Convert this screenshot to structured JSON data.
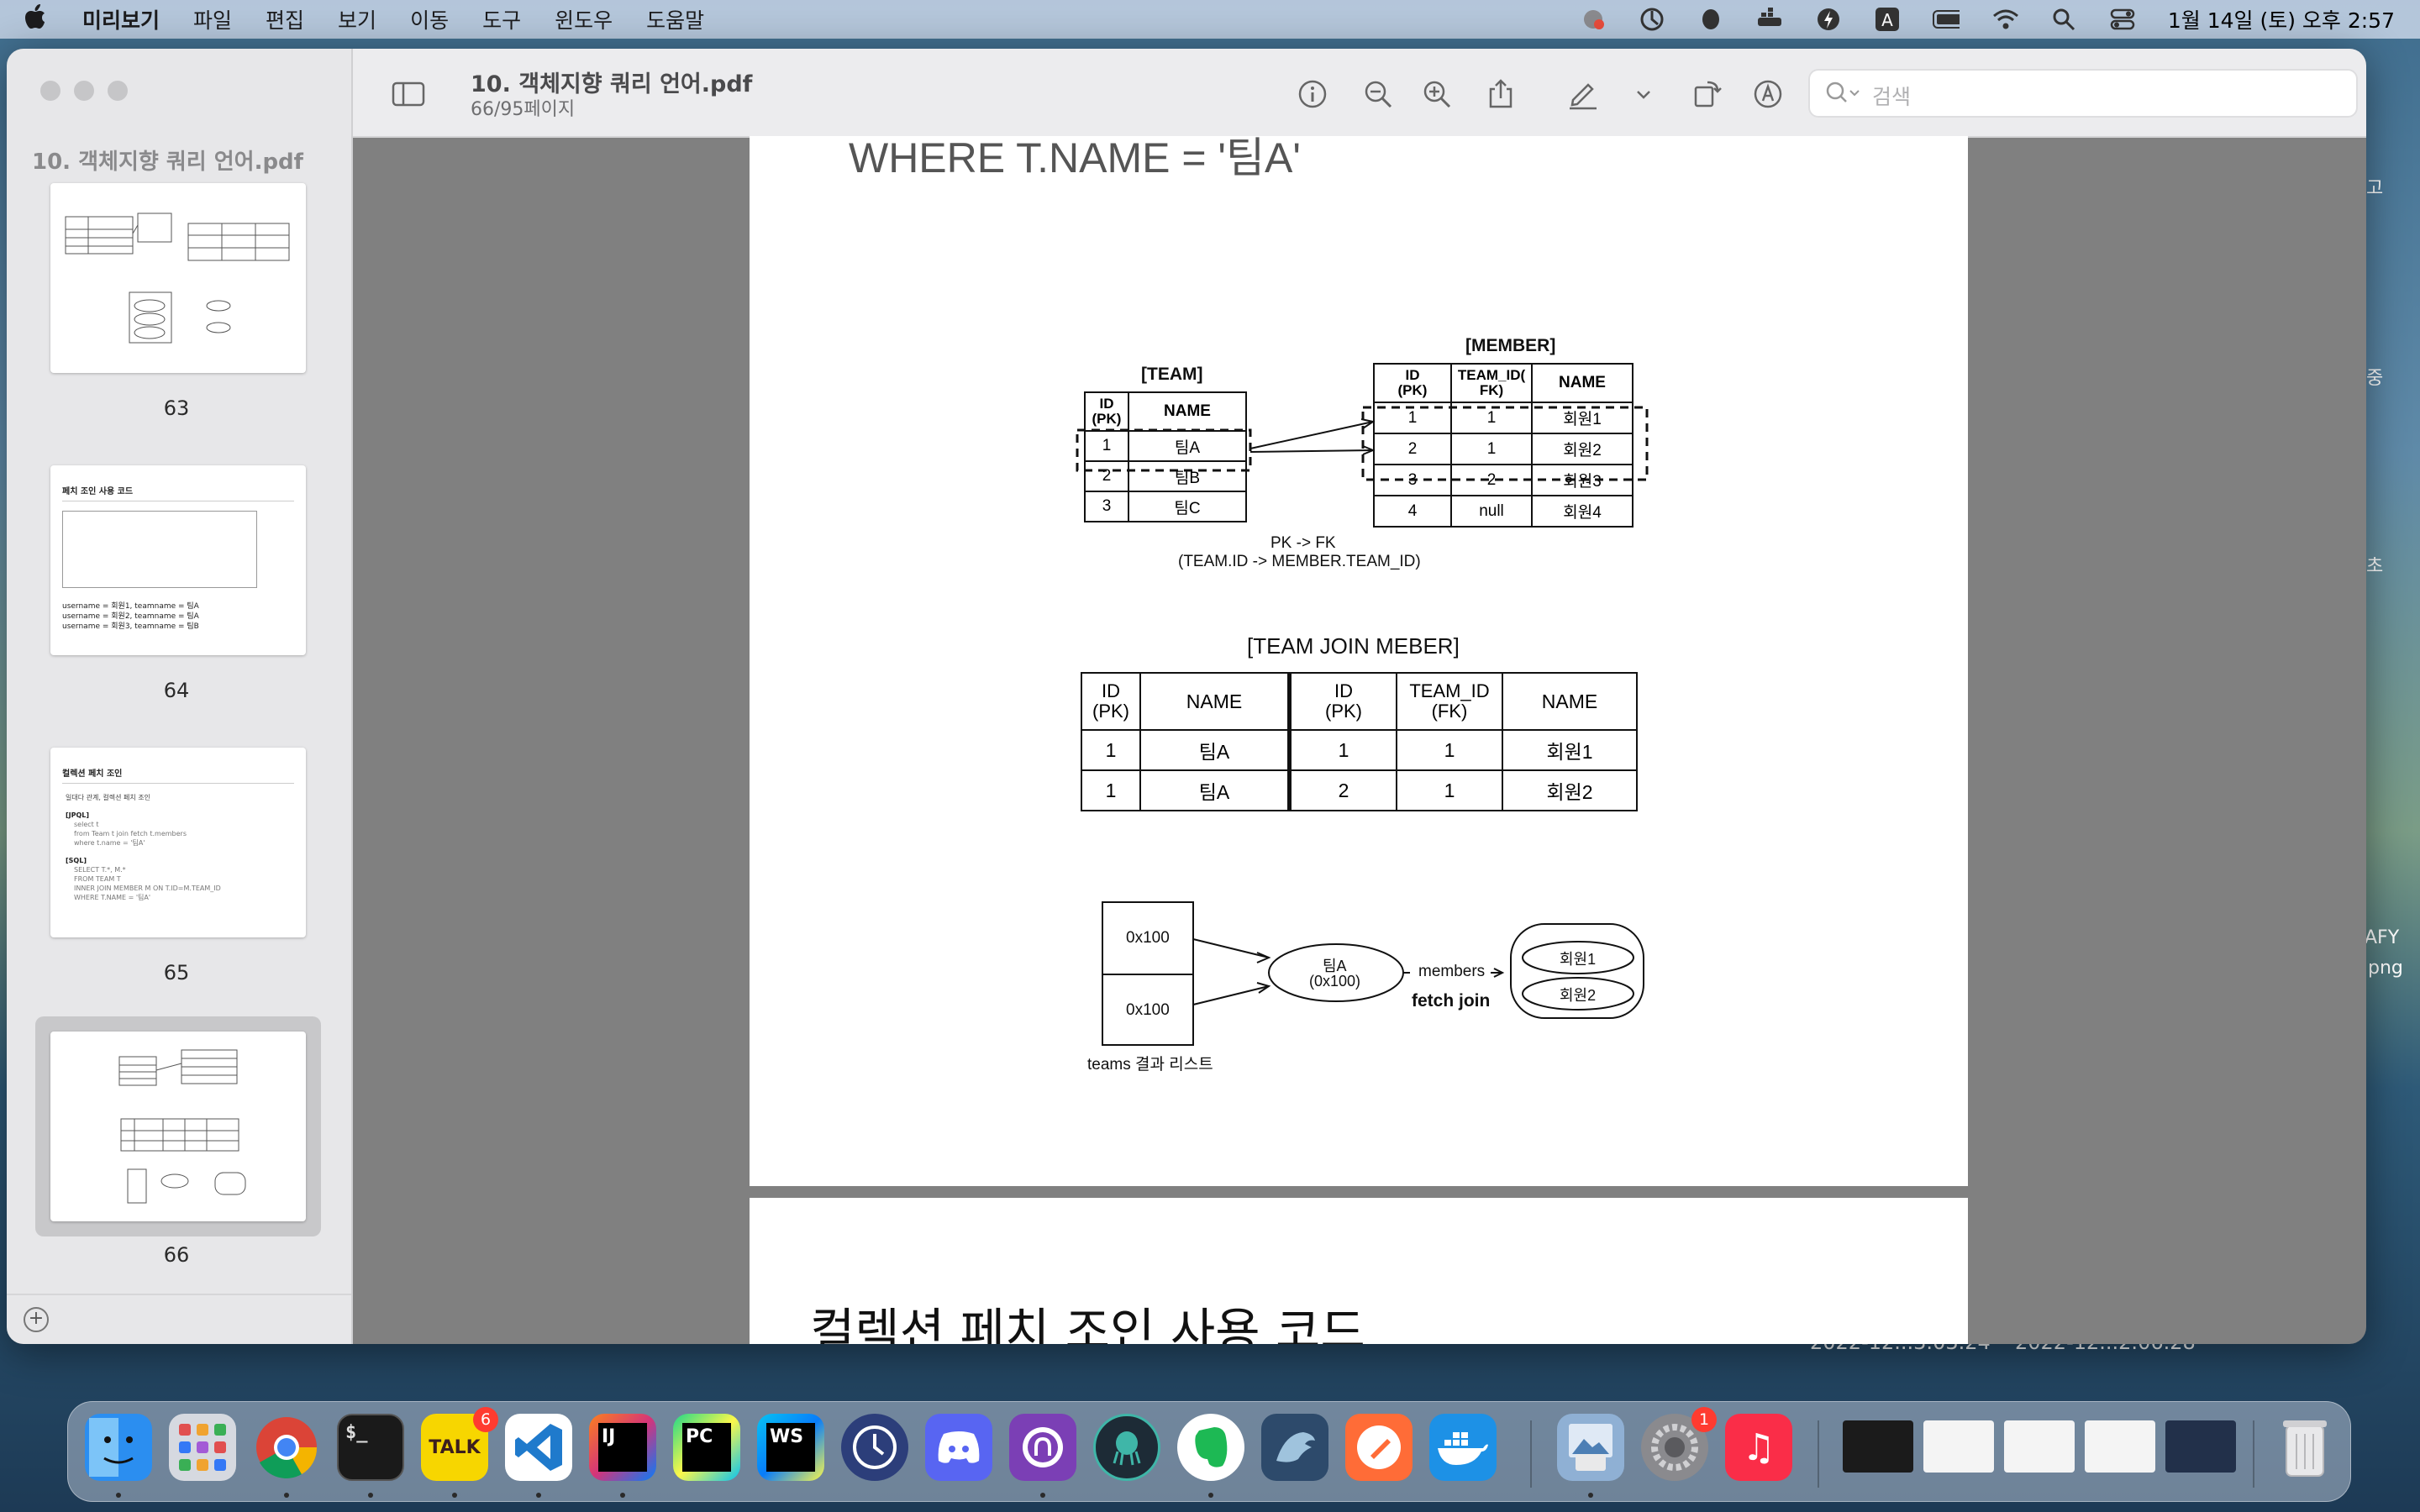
{
  "menubar": {
    "app": "미리보기",
    "items": [
      "파일",
      "편집",
      "보기",
      "이동",
      "도구",
      "윈도우",
      "도움말"
    ],
    "clock": "1월 14일 (토) 오후 2:57"
  },
  "window": {
    "doc_title": "10. 객체지향 쿼리 언어.pdf",
    "page_info": "66/95페이지",
    "search_placeholder": "검색"
  },
  "sidebar": {
    "title": "10. 객체지향 쿼리 언어.pdf",
    "thumbnails": [
      {
        "page": "63"
      },
      {
        "page": "64",
        "title": "페치 조인 사용 코드",
        "lines": [
          "username = 회원1, teamname = 팀A",
          "username = 회원2, teamname = 팀A",
          "username = 회원3, teamname = 팀B"
        ]
      },
      {
        "page": "65",
        "title": "컬렉션 페치 조인",
        "lines": [
          "일대다 관계, 컬렉션 페치 조인",
          "[JPQL]",
          "select t",
          "from Team t join fetch t.members",
          "where t.name = '팀A'",
          "[SQL]",
          "SELECT T.*, M.*",
          "FROM TEAM T",
          "INNER JOIN MEMBER M ON T.ID=M.TEAM_ID",
          "WHERE T.NAME = '팀A'"
        ]
      },
      {
        "page": "66"
      }
    ],
    "selected_page": "66"
  },
  "document": {
    "prev_page_tail": "WHERE T.NAME = '팀A'",
    "next_page_title": "컬렉션 페치 조인 사용 코드",
    "team_table": {
      "title": "[TEAM]",
      "headers": [
        "ID\n(PK)",
        "NAME"
      ],
      "rows": [
        [
          "1",
          "팀A"
        ],
        [
          "2",
          "팀B"
        ],
        [
          "3",
          "팀C"
        ]
      ]
    },
    "member_table": {
      "title": "[MEMBER]",
      "headers": [
        "ID\n(PK)",
        "TEAM_ID(\nFK)",
        "NAME"
      ],
      "rows": [
        [
          "1",
          "1",
          "회원1"
        ],
        [
          "2",
          "1",
          "회원2"
        ],
        [
          "3",
          "2",
          "회원3"
        ],
        [
          "4",
          "null",
          "회원4"
        ]
      ]
    },
    "fk_caption": [
      "PK -> FK",
      "(TEAM.ID -> MEMBER.TEAM_ID)"
    ],
    "join_table": {
      "title": "[TEAM JOIN MEBER]",
      "headers": [
        "ID\n(PK)",
        "NAME",
        "ID\n(PK)",
        "TEAM_ID\n(FK)",
        "NAME"
      ],
      "rows": [
        [
          "1",
          "팀A",
          "1",
          "1",
          "회원1"
        ],
        [
          "1",
          "팀A",
          "2",
          "1",
          "회원2"
        ]
      ]
    },
    "diagram": {
      "refs": [
        "0x100",
        "0x100"
      ],
      "list_label": "teams 결과 리스트",
      "entity": [
        "팀A",
        "(0x100)"
      ],
      "members_label": "members",
      "fetch_label": "fetch join",
      "members": [
        "회원1",
        "회원2"
      ]
    }
  },
  "desktop": {
    "right_labels": [
      "고",
      "중",
      "초",
      "AFY",
      "png"
    ],
    "file_labels": [
      "2022-12...3.03.24",
      "2022-12...2.06.28"
    ]
  },
  "dock": {
    "apps": [
      {
        "name": "Finder",
        "label": "",
        "color": "#2b8ef0"
      },
      {
        "name": "Launchpad",
        "label": "",
        "color": "#d6d9e0"
      },
      {
        "name": "Chrome",
        "label": "",
        "color": "#ffffff"
      },
      {
        "name": "Terminal",
        "label": "$_",
        "color": "#1a1a1a"
      },
      {
        "name": "KakaoTalk",
        "label": "TALK",
        "color": "#f7d600",
        "badge": "6"
      },
      {
        "name": "VS Code",
        "label": "<>",
        "color": "#1f7acc"
      },
      {
        "name": "IntelliJ IDEA",
        "label": "IJ",
        "color": "#d4347a"
      },
      {
        "name": "PyCharm",
        "label": "PC",
        "color": "#21c46f"
      },
      {
        "name": "WebStorm",
        "label": "WS",
        "color": "#1aa6d8"
      },
      {
        "name": "Clock",
        "label": "",
        "color": "#2c3e7a"
      },
      {
        "name": "Discord",
        "label": "",
        "color": "#5865f2"
      },
      {
        "name": "GitHub Desktop",
        "label": "",
        "color": "#7b3fb5"
      },
      {
        "name": "GitKraken",
        "label": "",
        "color": "#1d2b36"
      },
      {
        "name": "Evernote",
        "label": "",
        "color": "#1db954"
      },
      {
        "name": "MySQL Workbench",
        "label": "",
        "color": "#2d4a6b"
      },
      {
        "name": "Postman",
        "label": "",
        "color": "#ff6c37"
      },
      {
        "name": "Docker",
        "label": "",
        "color": "#1d91e6"
      },
      {
        "name": "Preview",
        "label": "",
        "color": "#8fb0d4"
      },
      {
        "name": "System Preferences",
        "label": "",
        "color": "#8a8a8e",
        "badge": "1"
      },
      {
        "name": "Music",
        "label": "♫",
        "color": "#fa2d48"
      }
    ]
  }
}
